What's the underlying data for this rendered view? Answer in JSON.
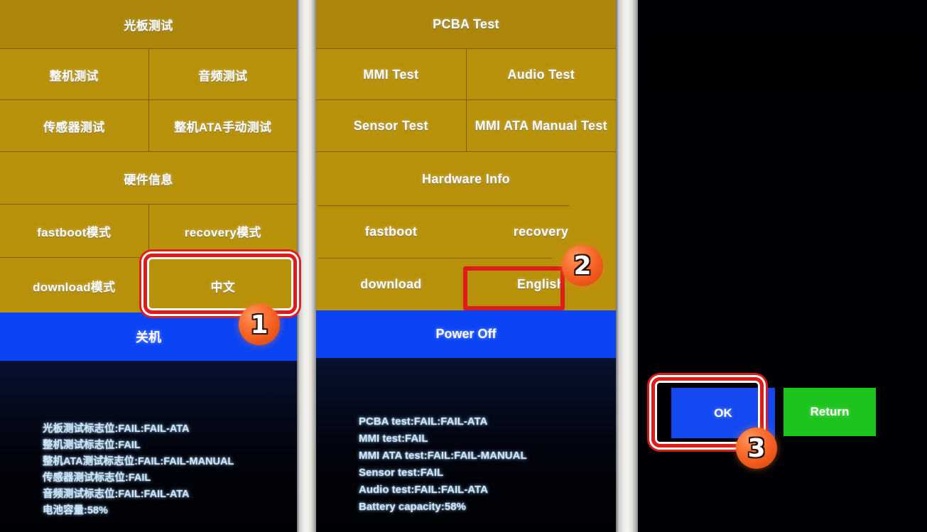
{
  "panels": {
    "chinese": {
      "header": "光板测试",
      "rows": [
        [
          "整机测试",
          "音频测试"
        ],
        [
          "传感器测试",
          "整机ATA手动测试"
        ],
        [
          "硬件信息"
        ],
        [
          "fastboot模式",
          "recovery模式"
        ],
        [
          "download模式",
          "中文"
        ]
      ],
      "power_off": "关机",
      "log": [
        "光板测试标志位:FAIL:FAIL-ATA",
        "整机测试标志位:FAIL",
        "整机ATA测试标志位:FAIL:FAIL-MANUAL",
        "传感器测试标志位:FAIL",
        "音频测试标志位:FAIL:FAIL-ATA",
        "电池容量:58%"
      ]
    },
    "english": {
      "header": "PCBA Test",
      "rows": [
        [
          "MMI Test",
          "Audio Test"
        ],
        [
          "Sensor Test",
          "MMI ATA Manual Test"
        ],
        [
          "Hardware Info"
        ],
        [
          "fastboot",
          "recovery"
        ],
        [
          "download",
          "English"
        ]
      ],
      "power_off": "Power Off",
      "log": [
        "PCBA test:FAIL:FAIL-ATA",
        "MMI test:FAIL",
        "MMI ATA test:FAIL:FAIL-MANUAL",
        "Sensor test:FAIL",
        "Audio test:FAIL:FAIL-ATA",
        "Battery capacity:58%"
      ]
    },
    "dialog": {
      "ok_label": "OK",
      "return_label": "Return"
    }
  },
  "annotations": {
    "steps": [
      {
        "number": "1",
        "target": "中文"
      },
      {
        "number": "2",
        "target": "English"
      },
      {
        "number": "3",
        "target": "OK"
      }
    ]
  },
  "colors": {
    "menu_yellow": "#b8910a",
    "menu_header_yellow": "#ab8609",
    "divider": "#7a5f06",
    "power_blue": "#0a44f5",
    "ok_blue": "#1449f2",
    "return_green": "#1ec41e",
    "highlight_red": "#e01b1b",
    "badge_orange": "#ef5a1c",
    "log_text": "#cfe6f7"
  }
}
